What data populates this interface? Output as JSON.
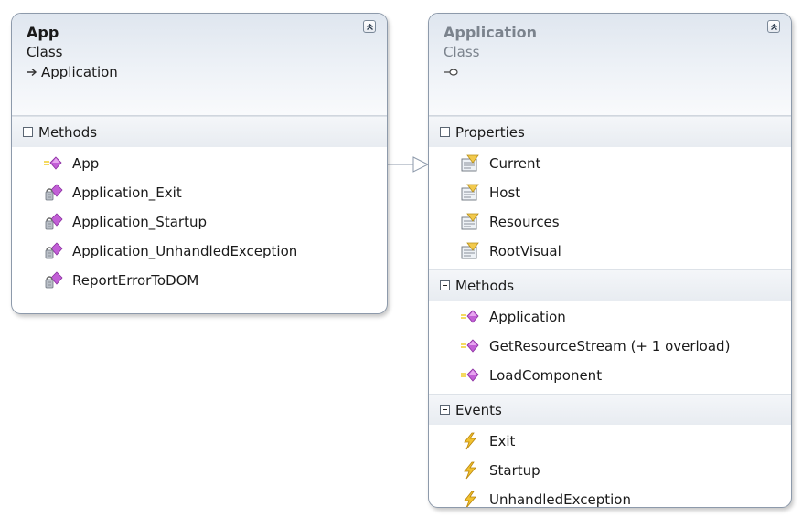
{
  "diagram": {
    "classes": [
      {
        "title": "App",
        "stereotype": "Class",
        "base": "Application",
        "sections": [
          {
            "label": "Methods",
            "members": [
              {
                "name": "App",
                "icon": "method-public-icon"
              },
              {
                "name": "Application_Exit",
                "icon": "method-private-icon"
              },
              {
                "name": "Application_Startup",
                "icon": "method-private-icon"
              },
              {
                "name": "Application_UnhandledException",
                "icon": "method-private-icon"
              },
              {
                "name": "ReportErrorToDOM",
                "icon": "method-private-icon"
              }
            ]
          }
        ]
      },
      {
        "title": "Application",
        "stereotype": "Class",
        "sections": [
          {
            "label": "Properties",
            "members": [
              {
                "name": "Current",
                "icon": "property-icon"
              },
              {
                "name": "Host",
                "icon": "property-icon"
              },
              {
                "name": "Resources",
                "icon": "property-icon"
              },
              {
                "name": "RootVisual",
                "icon": "property-icon"
              }
            ]
          },
          {
            "label": "Methods",
            "members": [
              {
                "name": "Application",
                "icon": "method-public-icon"
              },
              {
                "name": "GetResourceStream (+ 1 overload)",
                "icon": "method-public-icon"
              },
              {
                "name": "LoadComponent",
                "icon": "method-public-icon"
              }
            ]
          },
          {
            "label": "Events",
            "members": [
              {
                "name": "Exit",
                "icon": "event-icon"
              },
              {
                "name": "Startup",
                "icon": "event-icon"
              },
              {
                "name": "UnhandledException",
                "icon": "event-icon"
              }
            ]
          }
        ]
      }
    ],
    "colors": {
      "box_border": "#8d9aab",
      "method_icon": "#c25fd6",
      "event_icon": "#e8b400",
      "property_icon": "#f2c94c",
      "abstract_text": "#7b838d"
    }
  }
}
